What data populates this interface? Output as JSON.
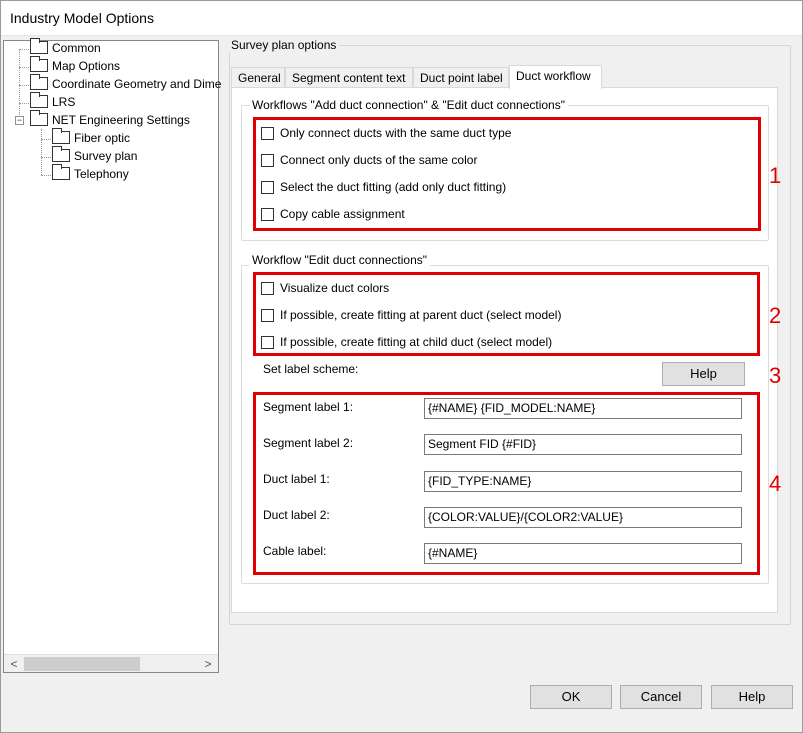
{
  "window": {
    "title": "Industry Model Options"
  },
  "tree": {
    "items": [
      {
        "label": "Common"
      },
      {
        "label": "Map Options"
      },
      {
        "label": "Coordinate Geometry and Dime"
      },
      {
        "label": "LRS"
      },
      {
        "label": "NET Engineering Settings",
        "expander": "−"
      },
      {
        "label": "Fiber optic"
      },
      {
        "label": "Survey plan"
      },
      {
        "label": "Telephony"
      }
    ],
    "scroll_left": "<",
    "scroll_right": ">"
  },
  "panel": {
    "group_label": "Survey plan options",
    "tabs": [
      {
        "label": "General"
      },
      {
        "label": "Segment content text"
      },
      {
        "label": "Duct point label"
      },
      {
        "label": "Duct workflow",
        "active": true
      }
    ]
  },
  "workflow_add_edit": {
    "label": "Workflows \"Add duct connection\" & \"Edit duct connections\"",
    "options": [
      {
        "label": "Only connect ducts with the same duct type",
        "checked": false
      },
      {
        "label": "Connect only ducts of the same color",
        "checked": false
      },
      {
        "label": "Select the duct fitting (add only duct fitting)",
        "checked": false
      },
      {
        "label": "Copy cable assignment",
        "checked": false
      }
    ]
  },
  "workflow_edit": {
    "label": "Workflow \"Edit duct connections\"",
    "options": [
      {
        "label": "Visualize duct colors",
        "checked": false
      },
      {
        "label": "If possible, create fitting at parent duct (select model)",
        "checked": false
      },
      {
        "label": "If possible, create fitting at child duct (select model)",
        "checked": false
      }
    ]
  },
  "label_scheme": {
    "label": "Set label scheme:",
    "help_button": "Help",
    "fields": [
      {
        "label": "Segment label 1:",
        "value": "{#NAME} {FID_MODEL:NAME}"
      },
      {
        "label": "Segment label 2:",
        "value": "Segment FID {#FID}"
      },
      {
        "label": "Duct label 1:",
        "value": "{FID_TYPE:NAME}"
      },
      {
        "label": "Duct label 2:",
        "value": "{COLOR:VALUE}/{COLOR2:VALUE}"
      },
      {
        "label": "Cable label:",
        "value": "{#NAME}"
      }
    ]
  },
  "annotations": {
    "n1": "1",
    "n2": "2",
    "n3": "3",
    "n4": "4"
  },
  "footer": {
    "ok": "OK",
    "cancel": "Cancel",
    "help": "Help"
  },
  "colors": {
    "annotation": "#e00000",
    "window_bg": "#f0f0f0"
  }
}
